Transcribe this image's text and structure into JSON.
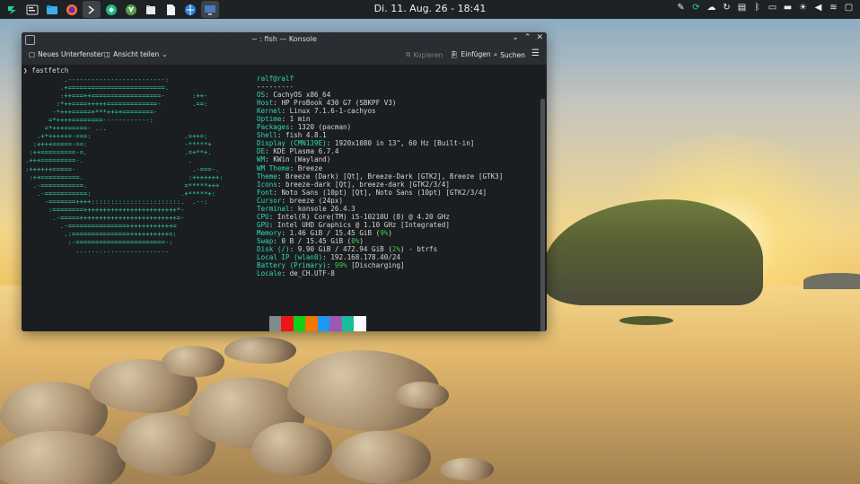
{
  "panel": {
    "clock": "Di. 11. Aug. 26 - 18:41",
    "launchers": [
      {
        "icon": "cachyos-icon"
      },
      {
        "icon": "system-settings-icon"
      },
      {
        "icon": "dolphin-icon"
      },
      {
        "icon": "firefox-icon"
      },
      {
        "icon": "konsole-icon"
      },
      {
        "icon": "update-icon"
      },
      {
        "icon": "vim-icon"
      },
      {
        "icon": "files-icon"
      },
      {
        "icon": "document-icon"
      },
      {
        "icon": "browser-icon"
      },
      {
        "icon": "screen-icon"
      }
    ],
    "tray": [
      "pen-icon",
      "cachy-update-icon",
      "cloud-icon",
      "sync-icon",
      "clipboard-icon",
      "bluetooth-icon",
      "device-icon",
      "battery-icon",
      "brightness-icon",
      "volume-icon",
      "wifi-icon",
      "panel-toggle-icon"
    ]
  },
  "window": {
    "title": "~ : fish — Konsole",
    "toolbar": {
      "new_tab": "Neues Unterfenster",
      "share_view": "Ansicht teilen",
      "copy": "Kopieren",
      "paste": "Einfügen",
      "search": "Suchen"
    },
    "terminal": {
      "prompt_cmd": "❯ fastfetch",
      "logo": "          .-------------------------:\n         .+=========================.\n         :++===++==================-       :++-\n        :*++====+++++=============-        .==:\n       -*+++=====+***++=+========-\n      =*++++========------------:\n     =*++++=====- ...\n   .+*+++++=-===:                        .=++=:\n  :++++=====-==:                         -*****+\n :++=========-=.                         .=+**+.\n.+++=========-.                           .\n:++++++=====-                              .-===-.\n :++==========.                           :+++++++:\n  .-===========.                         =*****+++\n   .-===========:                       .+*****+:\n     -=======++++:::::::::::::::::::::::.  .--:\n      :========++++++++++++++++++++++++*-\n       .-=====+++++++++++++++++++++++++=-\n         .-===============++++++++++++=\n          .:===============++++++++++=:\n           :-=======================-:\n             ........................",
      "header": "ralf@ralf",
      "separator": "---------",
      "info": [
        {
          "key": "OS",
          "value": "CachyOS x86_64"
        },
        {
          "key": "Host",
          "value": "HP ProBook 430 G7 (SBKPF V3)"
        },
        {
          "key": "Kernel",
          "value": "Linux 7.1.6-1-cachyos"
        },
        {
          "key": "Uptime",
          "value": "1 min"
        },
        {
          "key": "Packages",
          "value": "1320 (pacman)"
        },
        {
          "key": "Shell",
          "value": "fish 4.8.1"
        },
        {
          "key": "Display (CMN139E)",
          "value": "1920x1080 in 13\", 60 Hz [Built-in]"
        },
        {
          "key": "DE",
          "value": "KDE Plasma 6.7.4"
        },
        {
          "key": "WM",
          "value": "KWin (Wayland)"
        },
        {
          "key": "WM Theme",
          "value": "Breeze"
        },
        {
          "key": "Theme",
          "value": "Breeze (Dark) [Qt], Breeze-Dark [GTK2], Breeze [GTK3]"
        },
        {
          "key": "Icons",
          "value": "breeze-dark [Qt], breeze-dark [GTK2/3/4]"
        },
        {
          "key": "Font",
          "value": "Noto Sans (10pt) [Qt], Noto Sans (10pt) [GTK2/3/4]"
        },
        {
          "key": "Cursor",
          "value": "breeze (24px)"
        },
        {
          "key": "Terminal",
          "value": "konsole 26.4.3"
        },
        {
          "key": "CPU",
          "value": "Intel(R) Core(TM) i5-10210U (8) @ 4.20 GHz"
        },
        {
          "key": "GPU",
          "value": "Intel UHD Graphics @ 1.10 GHz [Integrated]"
        },
        {
          "key": "Memory",
          "value": "1.46 GiB / 15.45 GiB (9%)"
        },
        {
          "key": "Swap",
          "value": "0 B / 15.45 GiB (0%)"
        },
        {
          "key": "Disk (/)",
          "value": "9.90 GiB / 472.94 GiB (2%) - btrfs"
        },
        {
          "key": "Local IP (wlan0)",
          "value": "192.168.178.40/24"
        },
        {
          "key": "Battery (Primary)",
          "value": "99% [Discharging]"
        },
        {
          "key": "Locale",
          "value": "de_CH.UTF-8"
        }
      ],
      "swatches": [
        "#1b1e20",
        "#7f8c8d",
        "#ed1515",
        "#11d116",
        "#f67400",
        "#1d99f3",
        "#9b59b6",
        "#1abc9c",
        "#fcfcfc"
      ],
      "cursor_prompt": "❯ ▯"
    }
  }
}
